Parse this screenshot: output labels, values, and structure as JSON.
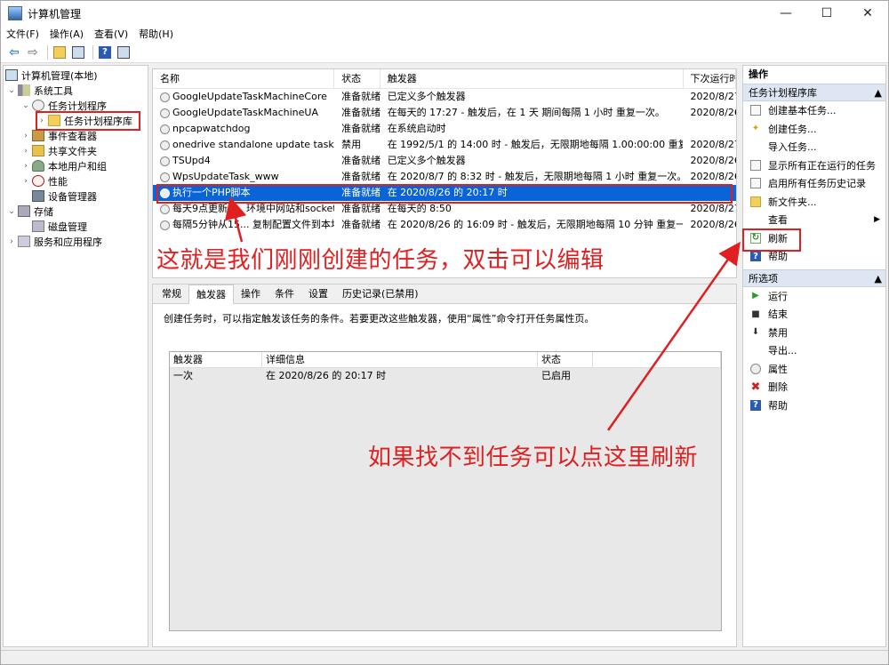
{
  "window": {
    "title": "计算机管理",
    "controls": [
      "—",
      "☐",
      "✕"
    ]
  },
  "menu": [
    "文件(F)",
    "操作(A)",
    "查看(V)",
    "帮助(H)"
  ],
  "toolbar": [
    "back-arrow-icon",
    "forward-arrow-icon",
    "folder-up-icon",
    "show-hide-tree-icon",
    "help-icon",
    "pane-icon"
  ],
  "tree": {
    "items": [
      {
        "label": "计算机管理(本地)",
        "icon": "computer-icon",
        "twisty": ""
      },
      {
        "label": "系统工具",
        "icon": "tools-icon",
        "twisty": "⌄"
      },
      {
        "label": "任务计划程序",
        "icon": "clock-icon",
        "twisty": "⌄"
      },
      {
        "label": "任务计划程序库",
        "icon": "folder-icon",
        "twisty": "›"
      },
      {
        "label": "事件查看器",
        "icon": "event-icon",
        "twisty": "›"
      },
      {
        "label": "共享文件夹",
        "icon": "share-icon",
        "twisty": "›"
      },
      {
        "label": "本地用户和组",
        "icon": "users-icon",
        "twisty": "›"
      },
      {
        "label": "性能",
        "icon": "performance-icon",
        "twisty": "›"
      },
      {
        "label": "设备管理器",
        "icon": "device-icon",
        "twisty": ""
      },
      {
        "label": "存储",
        "icon": "storage-icon",
        "twisty": "⌄"
      },
      {
        "label": "磁盘管理",
        "icon": "disk-icon",
        "twisty": ""
      },
      {
        "label": "服务和应用程序",
        "icon": "services-icon",
        "twisty": "›"
      }
    ]
  },
  "tasklist": {
    "columns": [
      "名称",
      "状态",
      "触发器",
      "下次运行时"
    ],
    "rows": [
      {
        "name": "GoogleUpdateTaskMachineCore",
        "status": "准备就绪",
        "trigger": "已定义多个触发器",
        "next": "2020/8/27"
      },
      {
        "name": "GoogleUpdateTaskMachineUA",
        "status": "准备就绪",
        "trigger": "在每天的 17:27 - 触发后，在 1 天 期间每隔 1 小时 重复一次。",
        "next": "2020/8/26"
      },
      {
        "name": "npcapwatchdog",
        "status": "准备就绪",
        "trigger": "在系统启动时",
        "next": ""
      },
      {
        "name": "onedrive standalone update task-...",
        "status": "禁用",
        "trigger": "在 1992/5/1 的 14:00 时 - 触发后，无限期地每隔 1.00:00:00 重复一...",
        "next": "2020/8/27"
      },
      {
        "name": "TSUpd4",
        "status": "准备就绪",
        "trigger": "已定义多个触发器",
        "next": "2020/8/26"
      },
      {
        "name": "WpsUpdateTask_www",
        "status": "准备就绪",
        "trigger": "在 2020/8/7 的 8:32 时 - 触发后，无限期地每隔 1 小时 重复一次。",
        "next": "2020/8/26"
      },
      {
        "name": "执行一个PHP脚本",
        "status": "准备就绪",
        "trigger": "在 2020/8/26 的 20:17 时",
        "next": ""
      },
      {
        "name": "每天9点更新1... 环境中网站和socket...",
        "status": "准备就绪",
        "trigger": "在每天的 8:50",
        "next": "2020/8/27"
      },
      {
        "name": "每隔5分钟从15... 复制配置文件到本地",
        "status": "准备就绪",
        "trigger": "在 2020/8/26 的 16:09 时 - 触发后，无限期地每隔 10 分钟 重复一次。",
        "next": "2020/8/26"
      }
    ]
  },
  "properties": {
    "tabs": [
      "常规",
      "触发器",
      "操作",
      "条件",
      "设置",
      "历史记录(已禁用)"
    ],
    "description": "创建任务时，可以指定触发该任务的条件。若要更改这些触发器，使用“属性”命令打开任务属性页。",
    "trigger_columns": [
      "触发器",
      "详细信息",
      "状态"
    ],
    "trigger_rows": [
      {
        "trigger": "一次",
        "detail": "在 2020/8/26 的 20:17 时",
        "status": "已启用"
      }
    ]
  },
  "actions": {
    "header": "操作",
    "section1": "任务计划程序库",
    "items1": [
      {
        "label": "创建基本任务...",
        "icon": "create-basic-icon"
      },
      {
        "label": "创建任务...",
        "icon": "create-task-icon"
      },
      {
        "label": "导入任务...",
        "icon": ""
      },
      {
        "label": "显示所有正在运行的任务",
        "icon": "running-tasks-icon"
      },
      {
        "label": "启用所有任务历史记录",
        "icon": "history-icon"
      },
      {
        "label": "新文件夹...",
        "icon": "new-folder-icon"
      },
      {
        "label": "查看",
        "icon": ""
      },
      {
        "label": "刷新",
        "icon": "refresh-icon"
      },
      {
        "label": "帮助",
        "icon": "help-icon"
      }
    ],
    "section2": "所选项",
    "items2": [
      {
        "label": "运行",
        "icon": "run-icon"
      },
      {
        "label": "结束",
        "icon": "stop-icon"
      },
      {
        "label": "禁用",
        "icon": "disable-icon"
      },
      {
        "label": "导出...",
        "icon": ""
      },
      {
        "label": "属性",
        "icon": "properties-icon"
      },
      {
        "label": "删除",
        "icon": "delete-icon"
      },
      {
        "label": "帮助",
        "icon": "help-icon"
      }
    ]
  },
  "annotations": {
    "task_note": "这就是我们刚刚创建的任务，双击可以编辑",
    "refresh_note": "如果找不到任务可以点这里刷新"
  },
  "colors": {
    "selection": "#0a64d8",
    "annotation": "#e02020"
  }
}
